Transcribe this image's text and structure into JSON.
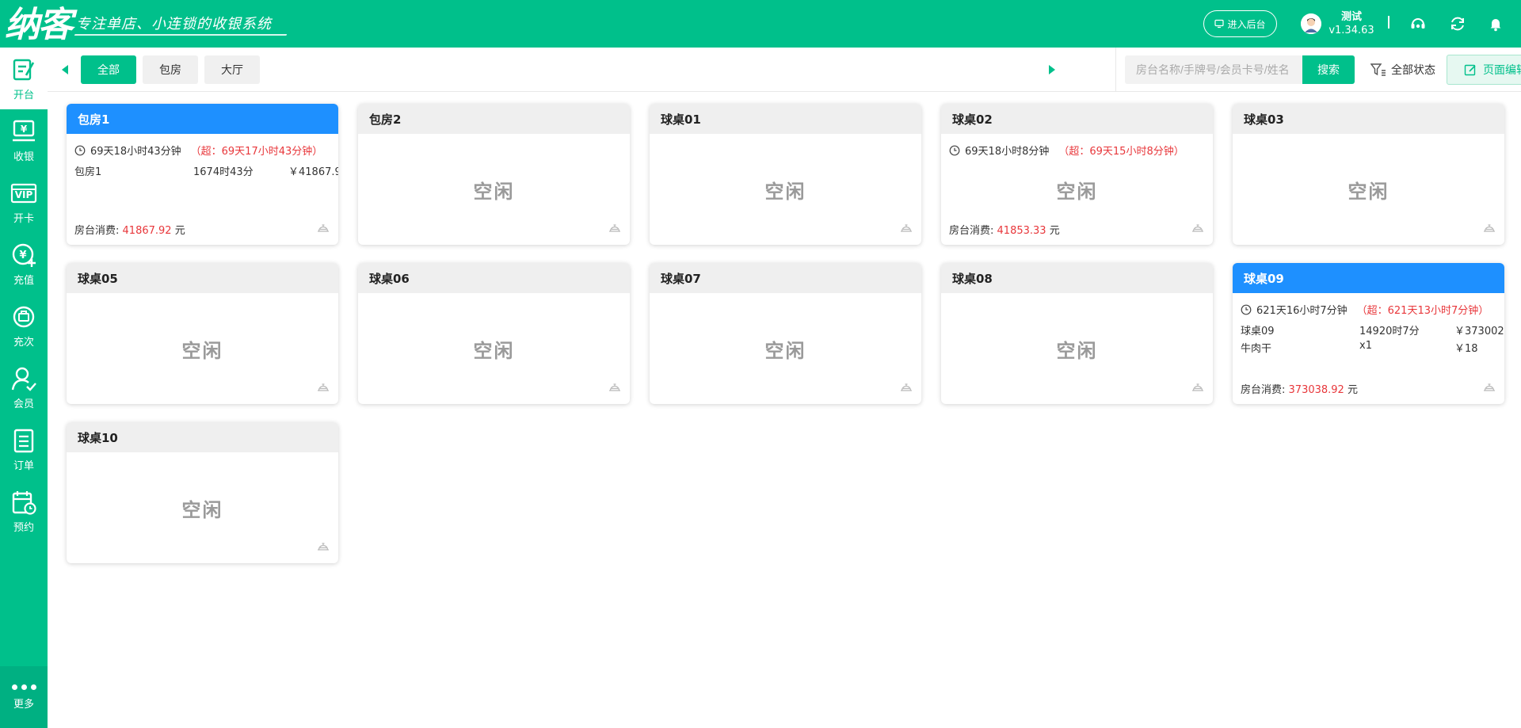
{
  "header": {
    "logo": "纳客",
    "slogan": "专注单店、小连锁的收银系统",
    "backend_label": "进入后台",
    "user_name": "测试",
    "version": "v1.34.63"
  },
  "sidebar": {
    "items": [
      {
        "label": "开台",
        "icon": "open-table-icon",
        "active": true
      },
      {
        "label": "收银",
        "icon": "cashier-icon"
      },
      {
        "label": "开卡",
        "icon": "vip-card-icon"
      },
      {
        "label": "充值",
        "icon": "recharge-icon"
      },
      {
        "label": "充次",
        "icon": "recharge-count-icon"
      },
      {
        "label": "会员",
        "icon": "member-icon"
      },
      {
        "label": "订单",
        "icon": "order-icon"
      },
      {
        "label": "预约",
        "icon": "reservation-icon"
      }
    ],
    "more_label": "更多"
  },
  "toolbar": {
    "tabs": [
      "全部",
      "包房",
      "大厅"
    ],
    "search_placeholder": "房台名称/手牌号/会员卡号/姓名",
    "search_label": "搜索",
    "filter_label": "全部状态",
    "page_edit_label": "页面编辑"
  },
  "colors": {
    "brand": "#00c08b",
    "occupied_header": "#1e90ff",
    "overtime": "#e8373b",
    "idle_text": "#9a9a9a"
  },
  "cards": [
    {
      "name": "包房1",
      "status": "occupied",
      "timer": "69天18小时43分钟",
      "overtime": "（超：69天17小时43分钟）",
      "items": [
        {
          "name": "包房1",
          "qty": "1674时43分",
          "price": "￥41867.9"
        }
      ],
      "total_label": "房台消费:",
      "total": "41867.92",
      "unit": "元"
    },
    {
      "name": "包房2",
      "status": "idle",
      "idle_label": "空闲"
    },
    {
      "name": "球桌01",
      "status": "idle",
      "idle_label": "空闲"
    },
    {
      "name": "球桌02",
      "status": "occupied_grey",
      "timer": "69天18小时8分钟",
      "overtime": "（超：69天15小时8分钟）",
      "items": [],
      "total_label": "房台消费:",
      "total": "41853.33",
      "unit": "元"
    },
    {
      "name": "球桌03",
      "status": "idle",
      "idle_label": "空闲"
    },
    {
      "name": "球桌05",
      "status": "idle",
      "idle_label": "空闲"
    },
    {
      "name": "球桌06",
      "status": "idle",
      "idle_label": "空闲"
    },
    {
      "name": "球桌07",
      "status": "idle",
      "idle_label": "空闲"
    },
    {
      "name": "球桌08",
      "status": "idle",
      "idle_label": "空闲"
    },
    {
      "name": "球桌09",
      "status": "occupied",
      "timer": "621天16小时7分钟",
      "overtime": "（超：621天13小时7分钟）",
      "items": [
        {
          "name": "球桌09",
          "qty": "14920时7分",
          "price": "￥373002."
        },
        {
          "name": "牛肉干",
          "qty": "x1",
          "price": "￥18"
        }
      ],
      "total_label": "房台消费:",
      "total": "373038.92",
      "unit": "元"
    },
    {
      "name": "球桌10",
      "status": "idle",
      "idle_label": "空闲"
    }
  ]
}
